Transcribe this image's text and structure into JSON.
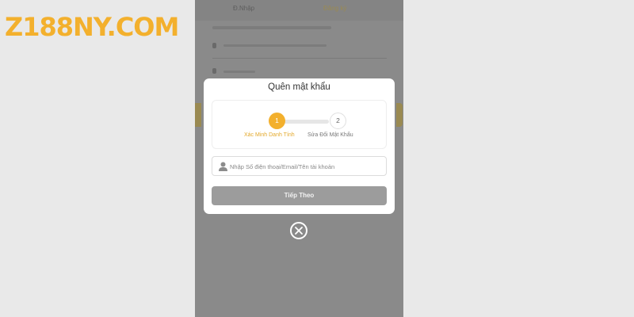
{
  "logo": {
    "text": "Z188NY.COM",
    "color": "#f3b02d"
  },
  "background_page": {
    "tabs": [
      "Đ.Nhập",
      "Đăng ký"
    ]
  },
  "modal": {
    "title": "Quên mật khẩu",
    "steps": [
      {
        "number": "1",
        "label": "Xác Minh Danh Tính",
        "active": true
      },
      {
        "number": "2",
        "label": "Sửa Đổi Mật Khẩu",
        "active": false
      }
    ],
    "input": {
      "placeholder": "Nhập Số điện thoại/Email/Tên tài khoản",
      "value": ""
    },
    "next_button_label": "Tiếp Theo",
    "close_icon": "close-circle-icon"
  },
  "colors": {
    "accent": "#f3b02d",
    "overlay": "#8a8a8a",
    "button_disabled": "#9c9c9c"
  }
}
